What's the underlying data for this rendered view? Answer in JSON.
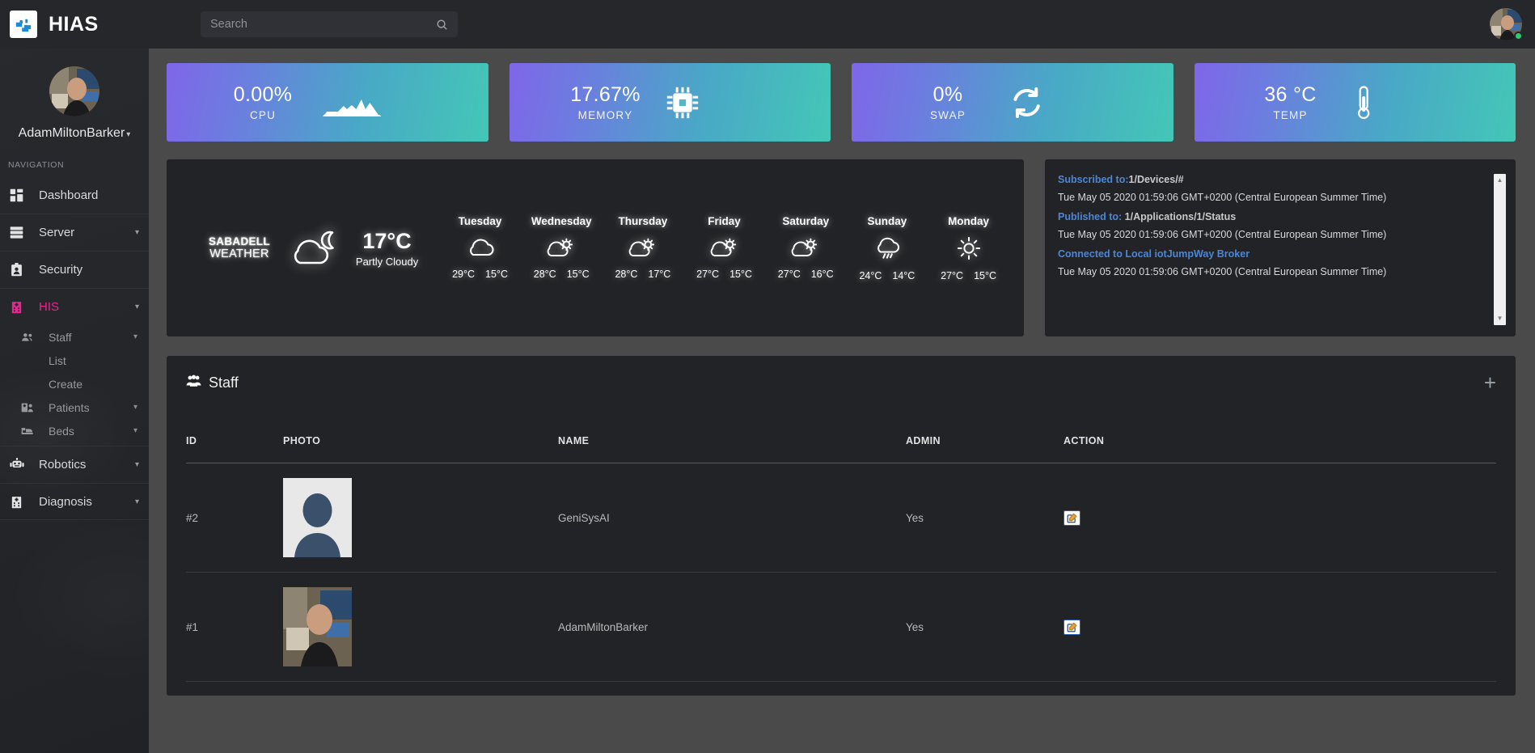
{
  "app": {
    "brand": "HIAS",
    "logo_icon": "hospital-cross-icon"
  },
  "search": {
    "placeholder": "Search",
    "value": "",
    "icon": "search-icon"
  },
  "topbar": {
    "avatar_name": "user-avatar",
    "status": "online"
  },
  "sidebar": {
    "profile_name": "AdamMiltonBarker",
    "nav_heading": "NAVIGATION",
    "items": [
      {
        "label": "Dashboard",
        "icon": "dashboard-grid-icon",
        "caret": false,
        "active": false
      },
      {
        "label": "Server",
        "icon": "server-icon",
        "caret": true,
        "active": false
      },
      {
        "label": "Security",
        "icon": "id-badge-icon",
        "caret": false,
        "active": false
      },
      {
        "label": "HIS",
        "icon": "hospital-icon",
        "caret": true,
        "active": true
      }
    ],
    "sub_items": [
      {
        "label": "Staff",
        "icon": "users-icon",
        "caret": true,
        "indent": false
      },
      {
        "label": "List",
        "icon": "",
        "caret": false,
        "indent": true
      },
      {
        "label": "Create",
        "icon": "",
        "caret": false,
        "indent": true
      },
      {
        "label": "Patients",
        "icon": "patients-icon",
        "caret": true,
        "indent": false
      },
      {
        "label": "Beds",
        "icon": "bed-icon",
        "caret": true,
        "indent": false
      }
    ],
    "items_bottom": [
      {
        "label": "Robotics",
        "icon": "robot-icon",
        "caret": true
      },
      {
        "label": "Diagnosis",
        "icon": "hospital2-icon",
        "caret": true
      }
    ]
  },
  "stats": [
    {
      "value": "0.00%",
      "label": "CPU",
      "icon": "mountain-chart-icon"
    },
    {
      "value": "17.67%",
      "label": "MEMORY",
      "icon": "microchip-icon"
    },
    {
      "value": "0%",
      "label": "SWAP",
      "icon": "sync-arrows-icon"
    },
    {
      "value": "36 °C",
      "label": "TEMP",
      "icon": "thermometer-icon"
    }
  ],
  "weather": {
    "city_line1": "SABADELL",
    "city_line2": "WEATHER",
    "current_icon": "cloud-moon-icon",
    "current_temp": "17°C",
    "current_desc": "Partly Cloudy",
    "forecast": [
      {
        "day": "Tuesday",
        "icon": "cloud-icon",
        "high": "29°C",
        "low": "15°C"
      },
      {
        "day": "Wednesday",
        "icon": "cloud-sun-icon",
        "high": "28°C",
        "low": "15°C"
      },
      {
        "day": "Thursday",
        "icon": "cloud-sun-icon",
        "high": "28°C",
        "low": "17°C"
      },
      {
        "day": "Friday",
        "icon": "cloud-sun-icon",
        "high": "27°C",
        "low": "15°C"
      },
      {
        "day": "Saturday",
        "icon": "cloud-sun-icon",
        "high": "27°C",
        "low": "16°C"
      },
      {
        "day": "Sunday",
        "icon": "cloud-rain-icon",
        "high": "24°C",
        "low": "14°C"
      },
      {
        "day": "Monday",
        "icon": "sun-icon",
        "high": "27°C",
        "low": "15°C"
      }
    ]
  },
  "log": {
    "entries": [
      {
        "title": "Subscribed to:",
        "title_rest": "1/Devices/#",
        "time": "Tue May 05 2020 01:59:06 GMT+0200 (Central European Summer Time)"
      },
      {
        "title": "Published to: ",
        "title_rest": "1/Applications/1/Status",
        "time": "Tue May 05 2020 01:59:06 GMT+0200 (Central European Summer Time)"
      },
      {
        "title": "Connected to Local iotJumpWay Broker",
        "title_rest": "",
        "time": "Tue May 05 2020 01:59:06 GMT+0200 (Central European Summer Time)"
      }
    ],
    "scroll_up": "▲",
    "scroll_down": "▼"
  },
  "staff_panel": {
    "title": "Staff",
    "title_icon": "users-icon",
    "add_label": "+",
    "columns": [
      "ID",
      "PHOTO",
      "NAME",
      "ADMIN",
      "ACTION"
    ],
    "rows": [
      {
        "id": "#2",
        "photo": "placeholder-avatar",
        "name": "GeniSysAI",
        "admin": "Yes",
        "action_icon": "edit-icon"
      },
      {
        "id": "#1",
        "photo": "user-photo",
        "name": "AdamMiltonBarker",
        "admin": "Yes",
        "action_icon": "edit-icon"
      }
    ]
  },
  "colors": {
    "accent_pink": "#e8268f",
    "link_blue": "#4a87d8",
    "card_gradient_start": "#7f66e8",
    "card_gradient_end": "#44c7b6",
    "panel_bg": "#222326",
    "app_bg": "#4a4a4a",
    "sidebar_bg": "#25272b",
    "status_green": "#2ecc71"
  }
}
